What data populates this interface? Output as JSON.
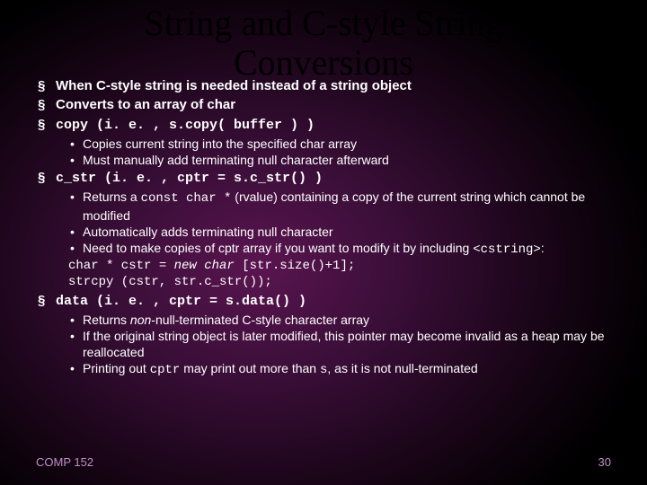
{
  "title_l1": "String and C-style String",
  "title_l2": "Conversions",
  "b1": "When C-style string is needed instead of a string object",
  "b2": "Converts to an array of char",
  "b3_pre": "copy",
  "b3_post": " (i. e. , s.copy( buffer ) )",
  "b3_s1": "Copies current string into the specified char array",
  "b3_s2": "Must manually add terminating null character afterward",
  "b4_pre": "c_str",
  "b4_post": " (i. e. , cptr = s.c_str() )",
  "b4_s1_a": "Returns a ",
  "b4_s1_code": "const char *",
  "b4_s1_b": " (rvalue) containing a copy of the current string which cannot be modified",
  "b4_s2": "Automatically adds terminating null character",
  "b4_s3_a": "Need to make copies of cptr array if you want to modify it by including ",
  "b4_s3_code": "<cstring>",
  "b4_s3_b": ":",
  "b4_code1_a": "char * cstr = ",
  "b4_code1_b": "new char",
  "b4_code1_c": " [str.size()+1];",
  "b4_code2": "strcpy (cstr, str.c_str());",
  "b5_pre": "data",
  "b5_post": " (i. e. , cptr = s.data() )",
  "b5_s1_a": "Returns ",
  "b5_s1_i": "non",
  "b5_s1_b": "-null-terminated C-style character array",
  "b5_s2": "If the original string object is later modified, this pointer may become invalid as a heap may be reallocated",
  "b5_s3_a": "Printing out ",
  "b5_s3_c1": "cptr",
  "b5_s3_b": " may print out more than ",
  "b5_s3_c2": "s",
  "b5_s3_c": ", as it is not null-terminated",
  "footer_left": "COMP 152",
  "footer_right": "30"
}
